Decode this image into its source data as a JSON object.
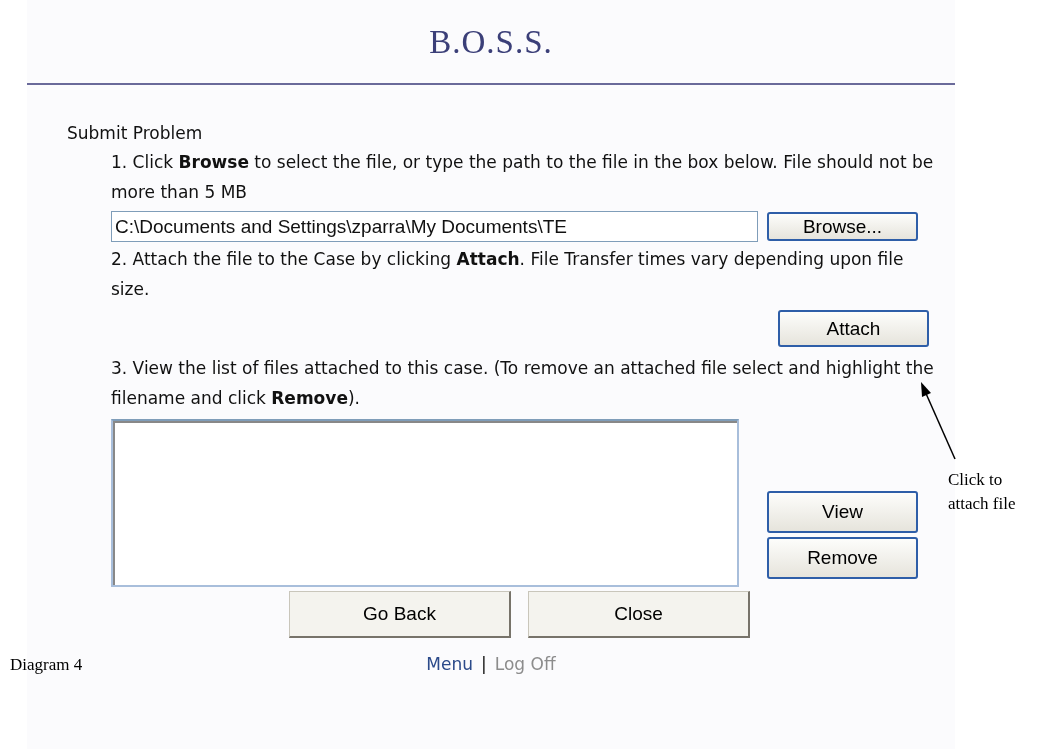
{
  "title": "B.O.S.S.",
  "section_title": "Submit Problem",
  "steps": [
    "1. Click **Browse** to select the file, or type the path to the file in the box below. File should not be more than 5 MB",
    "2. Attach the file to the Case by clicking **Attach**. File Transfer times vary depending upon file size.",
    "3. View the list of files attached to this case. (To remove an attached file select and highlight the filename and click **Remove**)."
  ],
  "file_field": {
    "value": "C:\\Documents and Settings\\zparra\\My Documents\\TE"
  },
  "browse_button": "Browse...",
  "attach_button": "Attach",
  "list_buttons": [
    "View",
    "Remove"
  ],
  "bottom_buttons": [
    "Go Back",
    "Close"
  ],
  "footer": {
    "links": [
      {
        "label": "Menu",
        "color": "#2b4a8a"
      },
      {
        "label": "Log Off",
        "color": "#8c8c8c"
      }
    ],
    "separator": "|"
  },
  "annotation": {
    "callout": "Click to attach file",
    "caption": "Diagram 4"
  }
}
